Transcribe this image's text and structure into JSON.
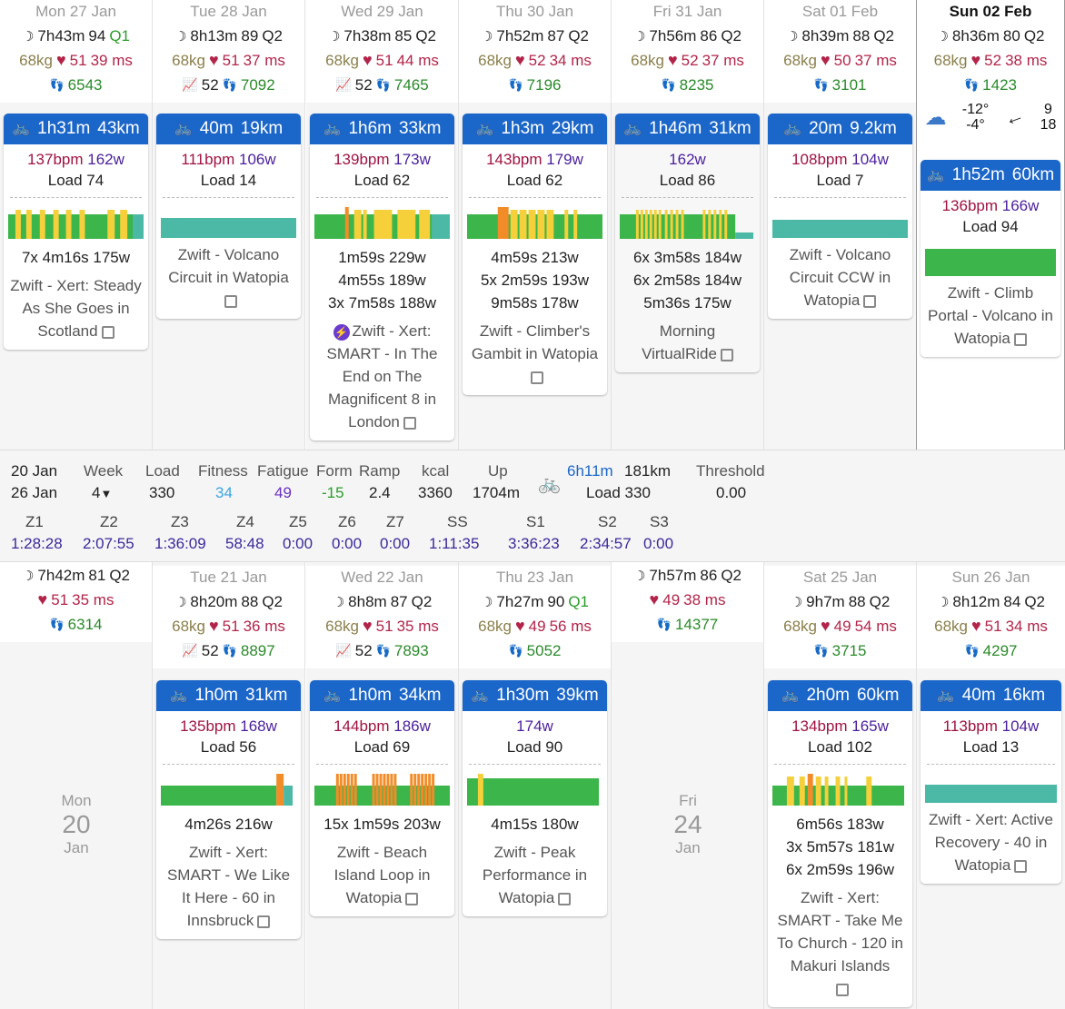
{
  "week1": [
    {
      "title": "Mon 27 Jan",
      "sleep": "7h43m",
      "score": "94",
      "q": "Q1",
      "qcolor": "green",
      "weight": "68kg",
      "hr": "51",
      "hrv": "39 ms",
      "steps": "6543",
      "act": {
        "dur": "1h31m",
        "dist": "43km",
        "bpm": "137bpm",
        "watts": "162w",
        "load": "Load 74",
        "ints": [
          "7x 4m16s 175w"
        ],
        "name": "Zwift - Xert: Steady As She Goes in Scotland",
        "bolt": false
      }
    },
    {
      "title": "Tue 28 Jan",
      "sleep": "8h13m",
      "score": "89",
      "q": "Q2",
      "weight": "68kg",
      "hr": "51",
      "hrv": "37 ms",
      "ecg": "52",
      "steps": "7092",
      "act": {
        "dur": "40m",
        "dist": "19km",
        "bpm": "111bpm",
        "watts": "106w",
        "load": "Load 14",
        "ints": [],
        "name": "Zwift - Volcano Circuit in Watopia"
      }
    },
    {
      "title": "Wed 29 Jan",
      "sleep": "7h38m",
      "score": "85",
      "q": "Q2",
      "weight": "68kg",
      "hr": "51",
      "hrv": "44 ms",
      "ecg": "52",
      "steps": "7465",
      "act": {
        "dur": "1h6m",
        "dist": "33km",
        "bpm": "139bpm",
        "watts": "173w",
        "load": "Load 62",
        "ints": [
          "1m59s 229w",
          "4m55s 189w",
          "3x 7m58s 188w"
        ],
        "name": "Zwift - Xert: SMART - In The End on The Magnificent 8 in London",
        "bolt": true
      }
    },
    {
      "title": "Thu 30 Jan",
      "sleep": "7h52m",
      "score": "87",
      "q": "Q2",
      "weight": "68kg",
      "hr": "52",
      "hrv": "34 ms",
      "steps": "7196",
      "act": {
        "dur": "1h3m",
        "dist": "29km",
        "bpm": "143bpm",
        "watts": "179w",
        "load": "Load 62",
        "ints": [
          "4m59s 213w",
          "5x 2m59s 193w",
          "9m58s 178w"
        ],
        "name": "Zwift - Climber's Gambit in Watopia"
      }
    },
    {
      "title": "Fri 31 Jan",
      "sleep": "7h56m",
      "score": "86",
      "q": "Q2",
      "weight": "68kg",
      "hr": "52",
      "hrv": "37 ms",
      "steps": "8235",
      "act": {
        "dur": "1h46m",
        "dist": "31km",
        "bpm": "",
        "watts": "162w",
        "load": "Load 86",
        "ints": [
          "6x 3m58s 184w",
          "6x 2m58s 184w",
          "5m36s 175w"
        ],
        "name": "Morning VirtualRide"
      }
    },
    {
      "title": "Sat 01 Feb",
      "sleep": "8h39m",
      "score": "88",
      "q": "Q2",
      "weight": "68kg",
      "hr": "50",
      "hrv": "37 ms",
      "steps": "3101",
      "act": {
        "dur": "20m",
        "dist": "9.2km",
        "bpm": "108bpm",
        "watts": "104w",
        "load": "Load 7",
        "ints": [],
        "name": "Zwift - Volcano Circuit CCW in Watopia"
      }
    },
    {
      "title": "Sun 02 Feb",
      "sleep": "8h36m",
      "score": "80",
      "q": "Q2",
      "weight": "68kg",
      "hr": "52",
      "hrv": "38 ms",
      "steps": "1423",
      "weather": {
        "hi": "-12°",
        "lo": "-4°",
        "wind1": "9",
        "wind2": "18"
      },
      "act": {
        "dur": "1h52m",
        "dist": "60km",
        "bpm": "136bpm",
        "watts": "166w",
        "load": "Load 94",
        "ints": [],
        "name": "Zwift - Climb Portal - Volcano in Watopia"
      }
    }
  ],
  "summary": {
    "range1": "20 Jan",
    "range2": "26 Jan",
    "week_label": "Week",
    "week_val": "4",
    "load_label": "Load",
    "load_val": "330",
    "fitness_label": "Fitness",
    "fitness_val": "34",
    "fatigue_label": "Fatigue",
    "fatigue_val": "49",
    "form_label": "Form",
    "form_val": "-15",
    "ramp_label": "Ramp",
    "ramp_val": "2.4",
    "kcal_label": "kcal",
    "kcal_val": "3360",
    "up_label": "Up",
    "up_val": "1704m",
    "ride_time": "6h11m",
    "ride_dist": "181km",
    "ride_load": "Load 330",
    "threshold_label": "Threshold",
    "threshold_val": "0.00",
    "zones": [
      {
        "l": "Z1",
        "v": "1:28:28"
      },
      {
        "l": "Z2",
        "v": "2:07:55"
      },
      {
        "l": "Z3",
        "v": "1:36:09"
      },
      {
        "l": "Z4",
        "v": "58:48"
      },
      {
        "l": "Z5",
        "v": "0:00"
      },
      {
        "l": "Z6",
        "v": "0:00"
      },
      {
        "l": "Z7",
        "v": "0:00"
      },
      {
        "l": "SS",
        "v": "1:11:35"
      },
      {
        "l": "S1",
        "v": "3:36:23"
      },
      {
        "l": "S2",
        "v": "2:34:57"
      },
      {
        "l": "S3",
        "v": "0:00"
      }
    ]
  },
  "week2": [
    {
      "title": "",
      "sleep": "7h42m",
      "score": "81",
      "q": "Q2",
      "hr": "51",
      "hrv": "35 ms",
      "steps": "6314",
      "big": {
        "dow": "Mon",
        "day": "20",
        "mon": "Jan"
      }
    },
    {
      "title": "Tue 21 Jan",
      "sleep": "8h20m",
      "score": "88",
      "q": "Q2",
      "weight": "68kg",
      "hr": "51",
      "hrv": "36 ms",
      "ecg": "52",
      "steps": "8897",
      "act": {
        "dur": "1h0m",
        "dist": "31km",
        "bpm": "135bpm",
        "watts": "168w",
        "load": "Load 56",
        "ints": [
          "4m26s 216w"
        ],
        "name": "Zwift - Xert: SMART - We Like It Here - 60 in Innsbruck"
      }
    },
    {
      "title": "Wed 22 Jan",
      "sleep": "8h8m",
      "score": "87",
      "q": "Q2",
      "weight": "68kg",
      "hr": "51",
      "hrv": "35 ms",
      "ecg": "52",
      "steps": "7893",
      "act": {
        "dur": "1h0m",
        "dist": "34km",
        "bpm": "144bpm",
        "watts": "186w",
        "load": "Load 69",
        "ints": [
          "15x 1m59s 203w"
        ],
        "name": "Zwift - Beach Island Loop in Watopia"
      }
    },
    {
      "title": "Thu 23 Jan",
      "sleep": "7h27m",
      "score": "90",
      "q": "Q1",
      "weight": "68kg",
      "hr": "49",
      "hrv": "56 ms",
      "steps": "5052",
      "act": {
        "dur": "1h30m",
        "dist": "39km",
        "bpm": "",
        "watts": "174w",
        "load": "Load 90",
        "ints": [
          "4m15s 180w"
        ],
        "name": "Zwift - Peak Performance in Watopia"
      }
    },
    {
      "title": "",
      "sleep": "7h57m",
      "score": "86",
      "q": "Q2",
      "hr": "49",
      "hrv": "38 ms",
      "steps": "14377",
      "big": {
        "dow": "Fri",
        "day": "24",
        "mon": "Jan"
      }
    },
    {
      "title": "Sat 25 Jan",
      "sleep": "9h7m",
      "score": "88",
      "q": "Q2",
      "weight": "68kg",
      "hr": "49",
      "hrv": "54 ms",
      "steps": "3715",
      "act": {
        "dur": "2h0m",
        "dist": "60km",
        "bpm": "134bpm",
        "watts": "165w",
        "load": "Load 102",
        "ints": [
          "6m56s 183w",
          "3x 5m57s 181w",
          "6x 2m59s 196w"
        ],
        "name": "Zwift - Xert: SMART - Take Me To Church - 120 in Makuri Islands"
      }
    },
    {
      "title": "Sun 26 Jan",
      "sleep": "8h12m",
      "score": "84",
      "q": "Q2",
      "weight": "68kg",
      "hr": "51",
      "hrv": "34 ms",
      "steps": "4297",
      "act": {
        "dur": "40m",
        "dist": "16km",
        "bpm": "113bpm",
        "watts": "104w",
        "load": "Load 13",
        "ints": [],
        "name": "Zwift - Xert: Active Recovery - 40 in Watopia"
      }
    }
  ]
}
